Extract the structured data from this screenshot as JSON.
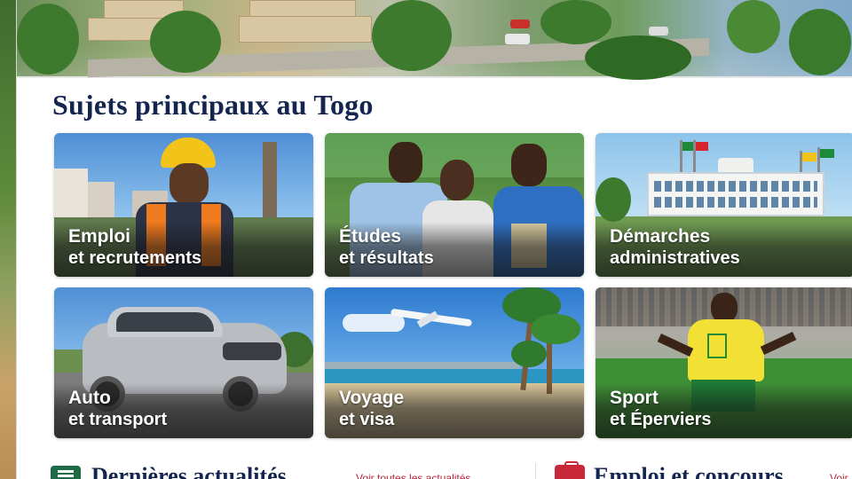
{
  "page": {
    "section_title": "Sujets principaux au Togo"
  },
  "cards": [
    {
      "line1": "Emploi",
      "line2": "et recrutements",
      "icon": "worker-photo"
    },
    {
      "line1": "Études",
      "line2": "et résultats",
      "icon": "students-photo"
    },
    {
      "line1": "Démarches",
      "line2": "administratives",
      "icon": "government-building-photo"
    },
    {
      "line1": "Auto",
      "line2": "et transport",
      "icon": "suv-car-photo"
    },
    {
      "line1": "Voyage",
      "line2": "et visa",
      "icon": "airplane-beach-photo"
    },
    {
      "line1": "Sport",
      "line2": "et Éperviers",
      "icon": "football-player-photo"
    }
  ],
  "bottom": {
    "news_title": "Dernières actualités",
    "news_link": "Voir toutes les actualités",
    "jobs_title": "Emploi et concours",
    "jobs_link": "Voir"
  },
  "colors": {
    "title": "#14264f",
    "link": "#b3243a",
    "news_icon": "#1f6b46",
    "jobs_icon": "#c8283a"
  }
}
